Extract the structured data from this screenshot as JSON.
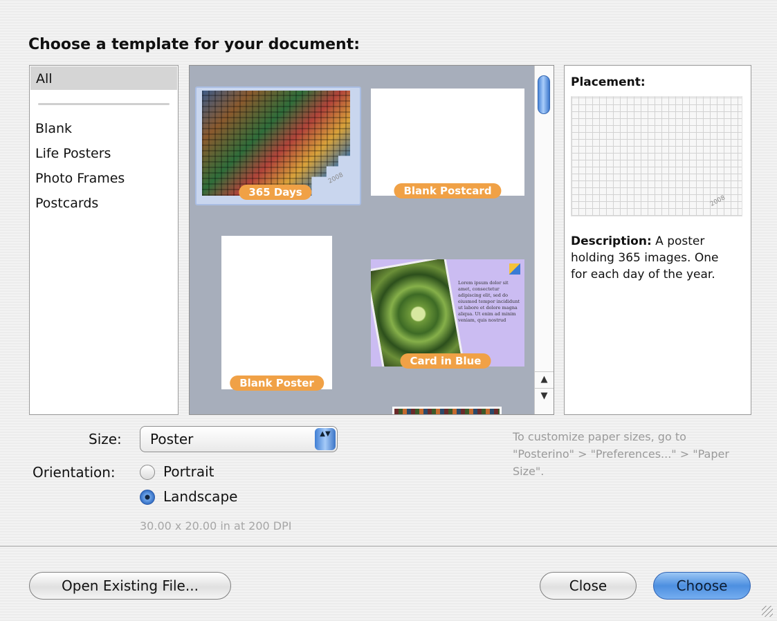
{
  "dialog": {
    "heading": "Choose a template for your document:"
  },
  "categories": {
    "selected": "All",
    "items": [
      "Blank",
      "Life Posters",
      "Photo Frames",
      "Postcards"
    ]
  },
  "templates": [
    {
      "label": "365 Days",
      "year": "2008"
    },
    {
      "label": "Blank Postcard"
    },
    {
      "label": "Blank Poster"
    },
    {
      "label": "Card in Blue",
      "body_text": "Lorem ipsum dolor sit amet, consectetur adipiscing elit, sed do eiusmod tempor incididunt ut labore et dolore magna aliqua. Ut enim ad minim veniam, quis nostrud"
    }
  ],
  "info": {
    "placement_label": "Placement:",
    "placement_year": "2008",
    "description_label": "Description:",
    "description_text": " A poster holding 365 images. One for each day of the year."
  },
  "form": {
    "size_label": "Size:",
    "size_value": "Poster",
    "orientation_label": "Orientation:",
    "portrait_label": "Portrait",
    "landscape_label": "Landscape",
    "orientation_selected": "Landscape",
    "dimensions": "30.00 x 20.00 in at 200 DPI",
    "hint": "To customize paper sizes, go to \"Posterino\" > \"Preferences...\" > \"Paper Size\"."
  },
  "buttons": {
    "open_existing": "Open Existing File...",
    "close": "Close",
    "choose": "Choose"
  },
  "icons": {
    "scroll_up": "▲",
    "scroll_down": "▼",
    "select_arrows": "▲▼"
  }
}
